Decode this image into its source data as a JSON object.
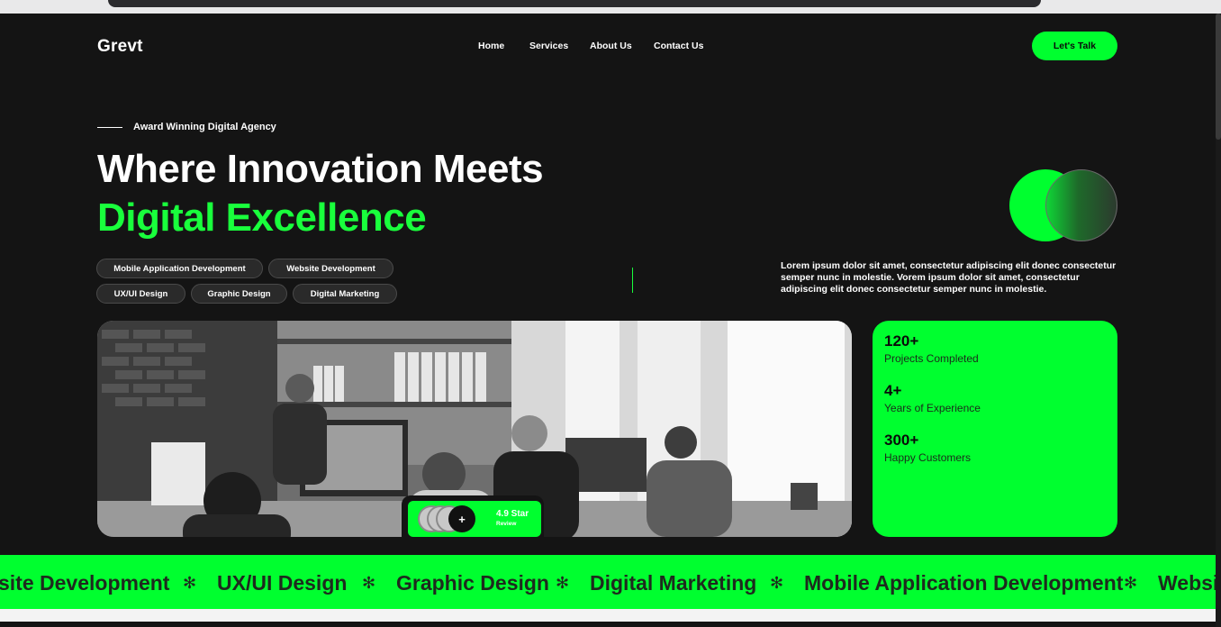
{
  "brand": {
    "logo": "Grevt",
    "accent": "#00ff2f"
  },
  "nav": {
    "items": [
      "Home",
      "Services",
      "About Us",
      "Contact Us"
    ],
    "cta": "Let's Talk"
  },
  "hero": {
    "eyebrow": "Award Winning Digital Agency",
    "title_line1": "Where Innovation Meets",
    "title_line2": "Digital Excellence",
    "tags": [
      "Mobile Application Development",
      "Website Development",
      "UX/UI Design",
      "Graphic Design",
      "Digital Marketing"
    ],
    "description": "Lorem ipsum dolor sit amet, consectetur adipiscing elit donec consectetur semper nunc in molestie. Vorem ipsum dolor sit amet, consectetur adipiscing elit donec consectetur semper nunc in molestie."
  },
  "review": {
    "plus": "+",
    "rating": "4.9 Star",
    "label": "Review"
  },
  "stats": [
    {
      "value": "120+",
      "label": "Projects Completed"
    },
    {
      "value": "4+",
      "label": "Years of Experience"
    },
    {
      "value": "300+",
      "label": "Happy Customers"
    }
  ],
  "marquee": {
    "items": [
      "site Development",
      "UX/UI Design",
      "Graphic Design",
      "Digital Marketing",
      "Mobile Application Development",
      "Websi"
    ],
    "separator": "✻"
  },
  "icons": {
    "photo": "office-team-photo",
    "separator": "asterisk-icon"
  }
}
